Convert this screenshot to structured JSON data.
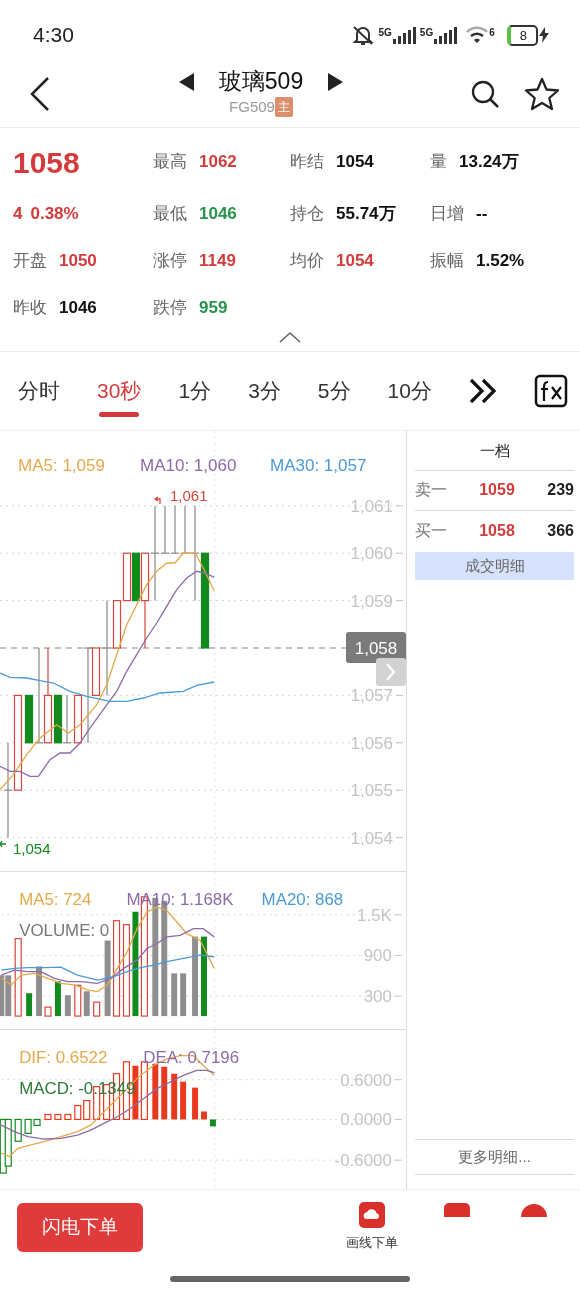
{
  "status_bar": {
    "time": "4:30",
    "signals": [
      "5G",
      "5G"
    ],
    "wifi_label": "6",
    "battery": "8"
  },
  "header": {
    "title": "玻璃509",
    "code": "FG509",
    "tag": "主"
  },
  "quote": {
    "rows": [
      [
        {
          "kind": "price",
          "value": "1058"
        },
        {
          "kind": "field",
          "label": "最高",
          "value": "1062",
          "color": "#d23c3c"
        },
        {
          "kind": "field",
          "label": "昨结",
          "value": "1054",
          "color": "#111111"
        },
        {
          "kind": "field",
          "label": "量",
          "value": "13.24万",
          "color": "#111111"
        }
      ],
      [
        {
          "kind": "change",
          "value": "4",
          "percent": "0.38%"
        },
        {
          "kind": "field",
          "label": "最低",
          "value": "1046",
          "color": "#26944a"
        },
        {
          "kind": "field",
          "label": "持仓",
          "value": "55.74万",
          "color": "#111111"
        },
        {
          "kind": "field",
          "label": "日增",
          "value": "--",
          "color": "#111111"
        }
      ],
      [
        {
          "kind": "field",
          "label": "开盘",
          "value": "1050",
          "color": "#d23c3c"
        },
        {
          "kind": "field",
          "label": "涨停",
          "value": "1149",
          "color": "#d23c3c"
        },
        {
          "kind": "field",
          "label": "均价",
          "value": "1054",
          "color": "#d23c3c"
        },
        {
          "kind": "field",
          "label": "振幅",
          "value": "1.52%",
          "color": "#111111"
        }
      ],
      [
        {
          "kind": "field",
          "label": "昨收",
          "value": "1046",
          "color": "#111111"
        },
        {
          "kind": "field",
          "label": "跌停",
          "value": "959",
          "color": "#26944a"
        }
      ]
    ]
  },
  "tabs": [
    {
      "label": "分时",
      "selected": false
    },
    {
      "label": "30秒",
      "selected": true
    },
    {
      "label": "1分",
      "selected": false
    },
    {
      "label": "3分",
      "selected": false
    },
    {
      "label": "5分",
      "selected": false
    },
    {
      "label": "10分",
      "selected": false
    }
  ],
  "main_chart": {
    "legend": [
      {
        "text": "MA5: 1,059",
        "color": "#e6a84a"
      },
      {
        "text": "MA10: 1,060",
        "color": "#8c6aa8"
      },
      {
        "text": "MA30: 1,057",
        "color": "#4a9ad6"
      }
    ],
    "high_label": "1,061",
    "low_label": "1,054",
    "last_price": "1,058",
    "y_ticks": [
      "1,061",
      "1,060",
      "1,059",
      "1,057",
      "1,056",
      "1,055",
      "1,054"
    ]
  },
  "volume_chart": {
    "legend": [
      {
        "text": "MA5: 724",
        "color": "#e6a84a"
      },
      {
        "text": "MA10: 1.168K",
        "color": "#8c6aa8"
      },
      {
        "text": "MA20: 868",
        "color": "#4a9ad6"
      }
    ],
    "volume_label": "VOLUME: 0",
    "y_ticks": [
      "1.5K",
      "900",
      "300"
    ]
  },
  "macd_chart": {
    "legend": [
      {
        "text": "DIF: 0.6522",
        "color": "#e6a84a"
      },
      {
        "text": "DEA: 0.7196",
        "color": "#8c6aa8"
      }
    ],
    "macd_label": "MACD: -0.1349",
    "y_ticks": [
      "0.6000",
      "0.0000",
      "-0.6000"
    ]
  },
  "order_book": {
    "title": "一档",
    "rows": [
      {
        "label": "卖一",
        "price": "1059",
        "volume": "239"
      },
      {
        "label": "买一",
        "price": "1058",
        "volume": "366"
      }
    ],
    "detail_button": "成交明细",
    "more_link": "更多明细..."
  },
  "bottom_bar": {
    "order_button": "闪电下单",
    "tool_label": "画线下单"
  }
}
